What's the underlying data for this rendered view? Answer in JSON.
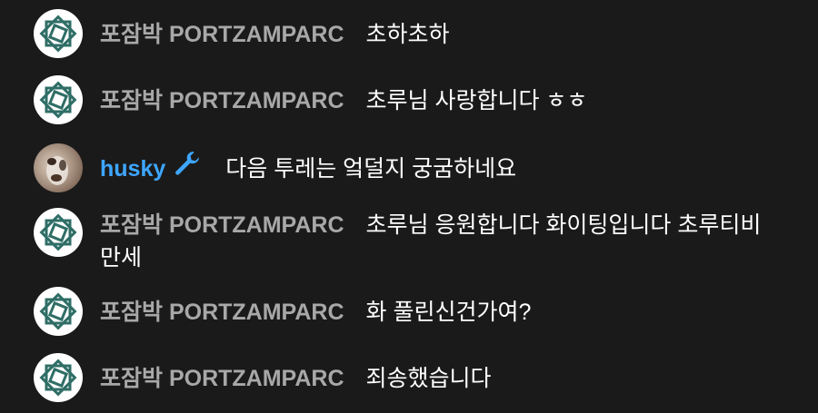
{
  "messages": [
    {
      "author": "포잠박 PORTZAMPARC",
      "text": "초하초하",
      "avatar": "portzamparc-logo"
    },
    {
      "author": "포잠박 PORTZAMPARC",
      "text": "초루님 사랑합니다 ㅎㅎ",
      "avatar": "portzamparc-logo"
    },
    {
      "author": "husky",
      "text": "다음 투레는 엌덜지 궁굼하네요",
      "avatar": "husky-photo",
      "badge": "wrench-icon",
      "author_color": "#3ea6ff"
    },
    {
      "author": "포잠박 PORTZAMPARC",
      "text": "초루님 응원합니다 화이팅입니다 초루티비 만세",
      "avatar": "portzamparc-logo"
    },
    {
      "author": "포잠박 PORTZAMPARC",
      "text": "화 풀린신건가여?",
      "avatar": "portzamparc-logo"
    },
    {
      "author": "포잠박 PORTZAMPARC",
      "text": "죄송했습니다",
      "avatar": "portzamparc-logo"
    }
  ],
  "colors": {
    "background": "#1a1a1a",
    "author": "#a8a8a8",
    "moderator": "#3ea6ff",
    "logo": "#2f6e66"
  }
}
